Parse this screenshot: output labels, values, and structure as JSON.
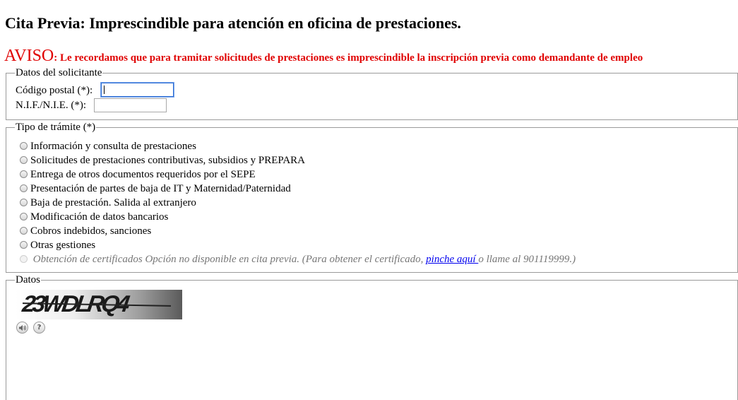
{
  "page": {
    "title": "Cita Previa: Imprescindible para atención en oficina de prestaciones."
  },
  "aviso": {
    "label": "AVISO",
    "text": ": Le recordamos que para tramitar solicitudes de prestaciones es imprescindible la inscripción previa como demandante de empleo",
    "color": "#e00000"
  },
  "solicitante": {
    "legend": "Datos del solicitante",
    "postal_label": "Código postal (*):",
    "postal_value": "",
    "nif_label": "N.I.F./N.I.E. (*):",
    "nif_value": ""
  },
  "tramite": {
    "legend": "Tipo de trámite (*)",
    "options": [
      "Información y consulta de prestaciones",
      "Solicitudes de prestaciones contributivas, subsidios y PREPARA",
      "Entrega de otros documentos requeridos por el SEPE",
      "Presentación de partes de baja de IT y Maternidad/Paternidad",
      "Baja de prestación. Salida al extranjero",
      "Modificación de datos bancarios",
      "Cobros indebidos, sanciones",
      "Otras gestiones"
    ],
    "disabled_option": {
      "prefix": "Obtención de certificados Opción no disponible en cita previa. (Para obtener el certificado, ",
      "link": "pinche aquí ",
      "suffix": "o llame al 901119999.)"
    }
  },
  "datos": {
    "legend": "Datos",
    "captcha_text": "23WDLRQ4",
    "audio_icon": "speaker-icon",
    "help_icon": "help-icon",
    "help_glyph": "?"
  }
}
